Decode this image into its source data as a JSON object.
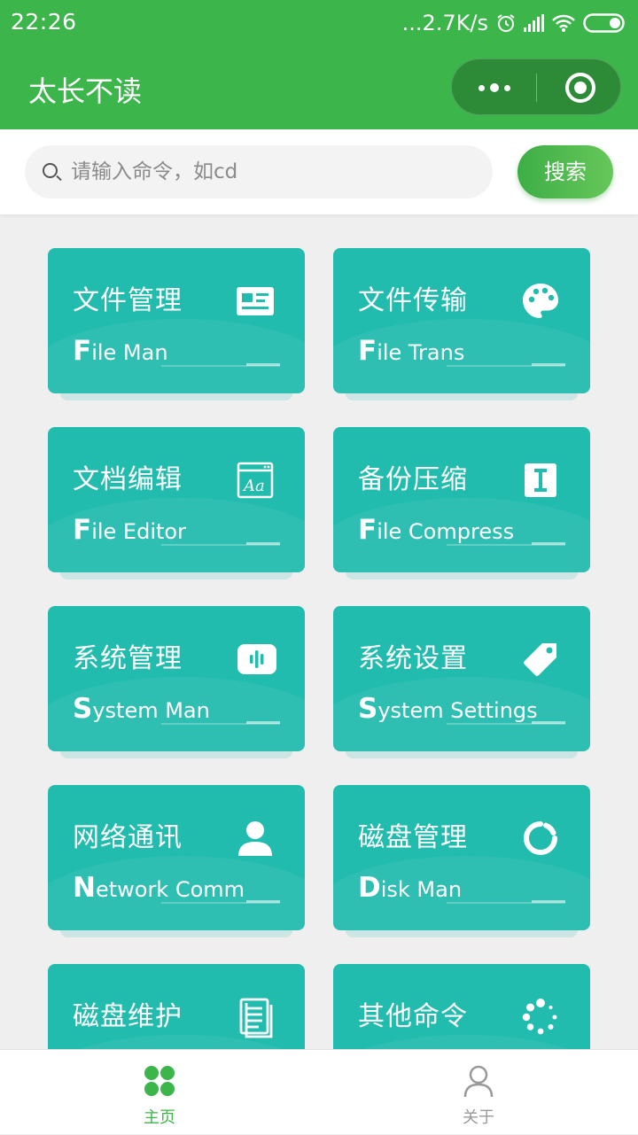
{
  "status_bar": {
    "time": "22:26",
    "speed": "...2.7K/s"
  },
  "nav": {
    "title": "太长不读"
  },
  "search": {
    "placeholder": "请输入命令，如cd",
    "button_label": "搜索"
  },
  "cards": [
    {
      "title": "文件管理",
      "sub_cap": "F",
      "sub_rest": "ile Man",
      "icon": "id-card-icon"
    },
    {
      "title": "文件传输",
      "sub_cap": "F",
      "sub_rest": "ile Trans",
      "icon": "palette-icon"
    },
    {
      "title": "文档编辑",
      "sub_cap": "F",
      "sub_rest": "ile Editor",
      "icon": "font-window-icon"
    },
    {
      "title": "备份压缩",
      "sub_cap": "F",
      "sub_rest": "ile Compress",
      "icon": "text-cursor-icon"
    },
    {
      "title": "系统管理",
      "sub_cap": "S",
      "sub_rest": "ystem Man",
      "icon": "waveform-icon"
    },
    {
      "title": "系统设置",
      "sub_cap": "S",
      "sub_rest": "ystem Settings",
      "icon": "tag-icon"
    },
    {
      "title": "网络通讯",
      "sub_cap": "N",
      "sub_rest": "etwork Comm",
      "icon": "user-icon"
    },
    {
      "title": "磁盘管理",
      "sub_cap": "D",
      "sub_rest": "isk Man",
      "icon": "loading-ring-icon"
    },
    {
      "title": "磁盘维护",
      "sub_cap": "",
      "sub_rest": "",
      "icon": "document-icon"
    },
    {
      "title": "其他命令",
      "sub_cap": "",
      "sub_rest": "",
      "icon": "spinner-dots-icon"
    }
  ],
  "tabs": [
    {
      "label": "主页",
      "icon": "home-grid-icon",
      "active": true
    },
    {
      "label": "关于",
      "icon": "person-icon",
      "active": false
    }
  ],
  "colors": {
    "primary_green": "#3cb54a",
    "card_teal": "#21bcae",
    "tab_inactive": "#999999"
  }
}
